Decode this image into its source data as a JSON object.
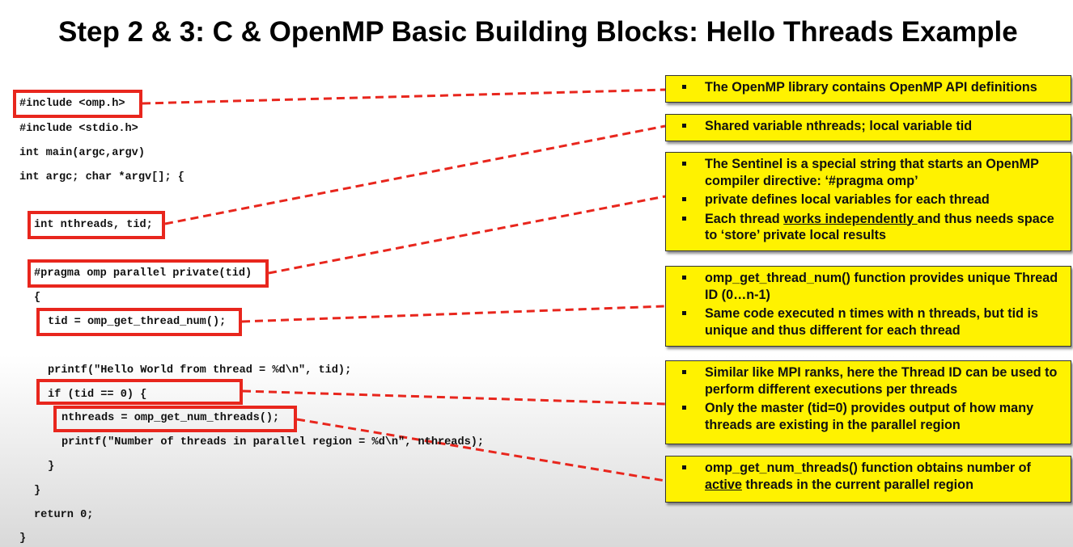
{
  "title": "Step 2 & 3: C & OpenMP Basic Building Blocks: Hello Threads Example",
  "colors": {
    "highlight": "#e8261d",
    "note_bg": "#fff200",
    "dash": "#e8261d"
  },
  "code": {
    "l1": "#include <omp.h>",
    "l2": "#include <stdio.h>",
    "l3": "int main(argc,argv)",
    "l4": "int argc; char *argv[]; {",
    "l5": "int nthreads, tid;",
    "l6": "#pragma omp parallel private(tid)",
    "l7": "{",
    "l8": "tid = omp_get_thread_num();",
    "l9": "printf(\"Hello World from thread = %d\\n\", tid);",
    "l10": "if (tid == 0) {",
    "l11": "nthreads = omp_get_num_threads();",
    "l12": "printf(\"Number of threads in parallel region = %d\\n\", nthreads);",
    "l13": "}",
    "l14": "}",
    "l15": "return 0;",
    "l16": "}"
  },
  "notes": {
    "n1": {
      "b1": "The OpenMP library contains OpenMP API definitions"
    },
    "n2": {
      "b1": "Shared variable nthreads; local variable tid"
    },
    "n3": {
      "b1": "The Sentinel is a special string that starts an OpenMP compiler directive: ‘#pragma omp’",
      "b2": "private defines local variables for each thread",
      "b3_pre": "Each thread ",
      "b3_ul": "works independently ",
      "b3_post": "and thus needs space to ‘store’ private local results"
    },
    "n4": {
      "b1": "omp_get_thread_num() function provides unique Thread ID (0…n-1)",
      "b2": "Same code executed n times with n threads, but tid is unique and thus different for each thread"
    },
    "n5": {
      "b1": "Similar like MPI ranks, here the Thread ID can be used to perform different executions per threads",
      "b2": "Only the master (tid=0) provides output of how many threads are existing in the parallel region"
    },
    "n6": {
      "b1": "omp_get_num_threads() function obtains number of",
      "b2_ul": "active",
      "b2_post": " threads in the current parallel region"
    }
  }
}
